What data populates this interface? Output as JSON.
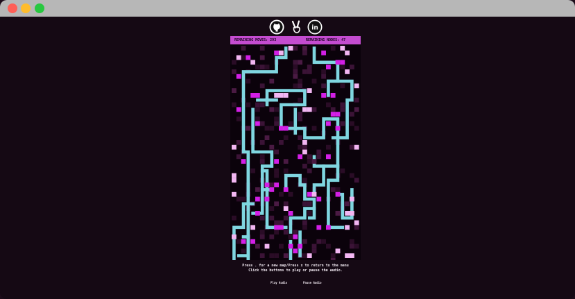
{
  "window": {
    "controls": [
      "close",
      "minimize",
      "maximize"
    ]
  },
  "header": {
    "icons": [
      "github-icon",
      "victory-hand-icon",
      "linkedin-icon"
    ],
    "linkedin_text": "in"
  },
  "hud": {
    "remaining_moves": "REMAINING MOVES: 293",
    "remaining_nodes": "REMAINING NODES: 47"
  },
  "instructions": {
    "line1": "Press . for a new map/Press x to return to the menu",
    "line2": "Click the buttons to play or pause the audio."
  },
  "buttons": {
    "play_audio": "Play Audio",
    "pause_audio": "Pause Audio"
  },
  "colors": {
    "hud_bar": "#c44cd0",
    "path": "#7fd6e0",
    "node_magenta": "#d31fe6",
    "node_pink": "#f2b6f2",
    "node_dark": "#4a1a43",
    "background": "#150914"
  }
}
